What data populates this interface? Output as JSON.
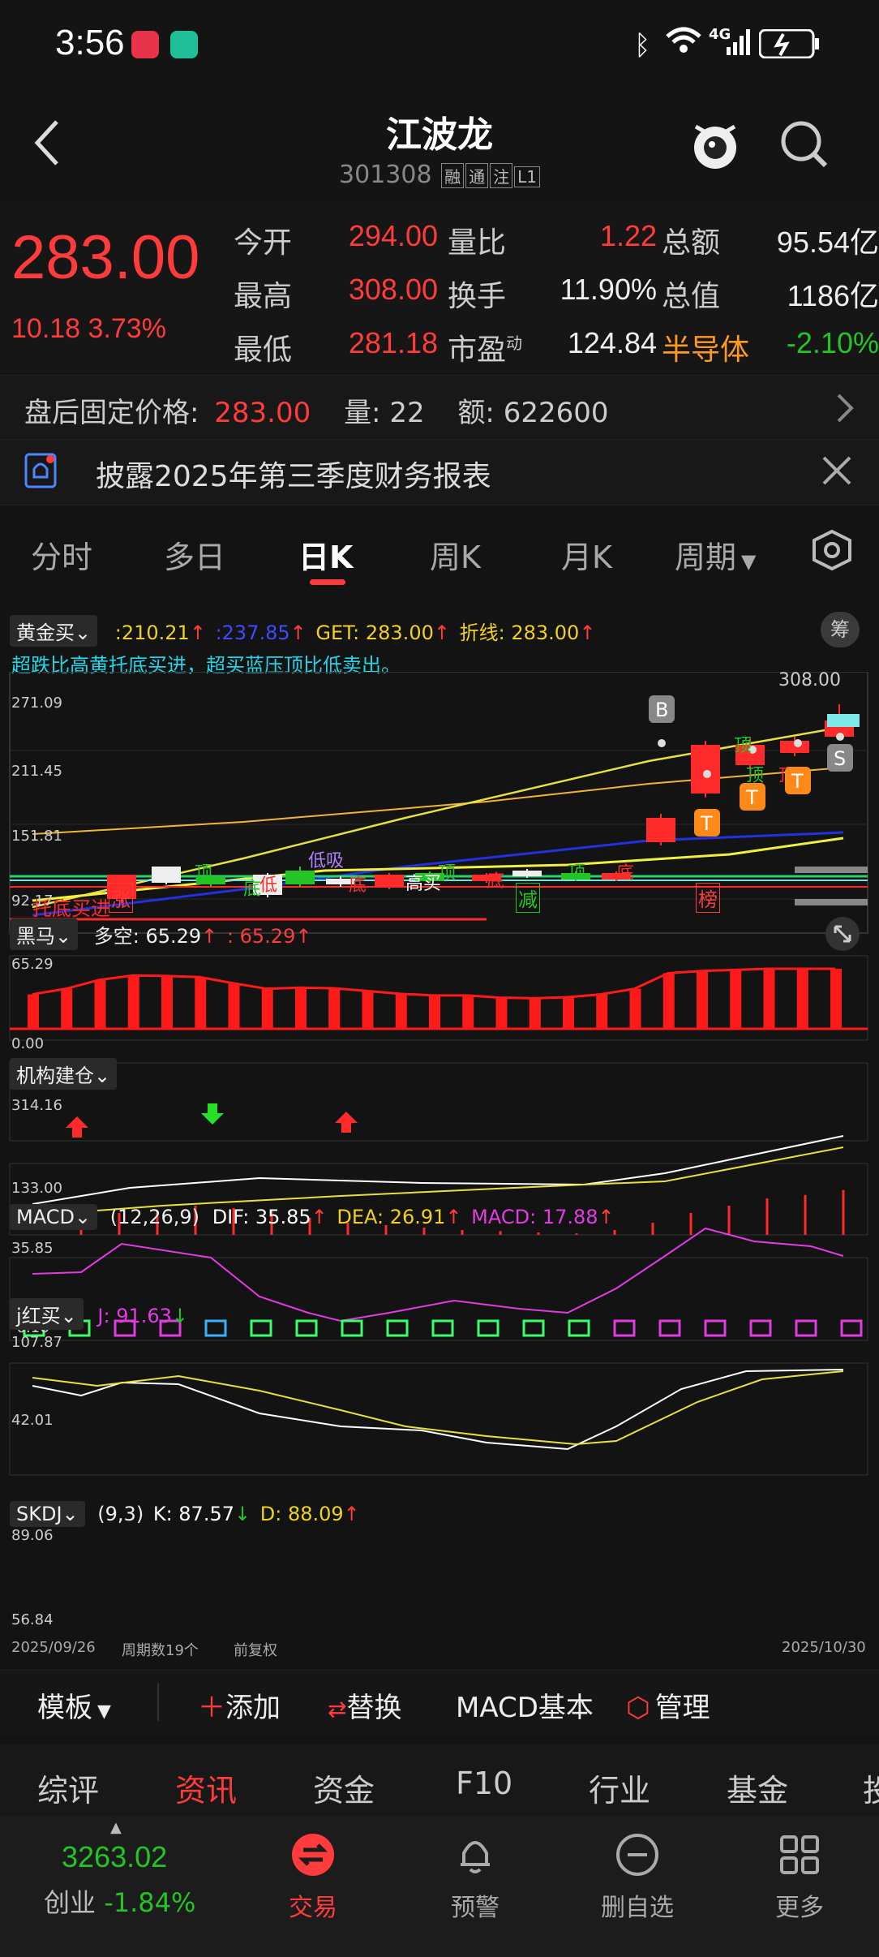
{
  "status": {
    "time": "3:56",
    "network": "4G"
  },
  "header": {
    "title": "江波龙",
    "code": "301308",
    "tags": [
      "融",
      "通",
      "注",
      "L1"
    ]
  },
  "quote": {
    "price": "283.00",
    "change": "10.18",
    "change_pct": "3.73%",
    "rows": [
      [
        {
          "l": "今开",
          "v": "294.00",
          "c": "red"
        },
        {
          "l": "量比",
          "v": "1.22",
          "c": "red"
        },
        {
          "l": "总额",
          "v": "95.54亿",
          "c": "white"
        }
      ],
      [
        {
          "l": "最高",
          "v": "308.00",
          "c": "red"
        },
        {
          "l": "换手",
          "v": "11.90%",
          "c": "white"
        },
        {
          "l": "总值",
          "v": "1186亿",
          "c": "white"
        }
      ],
      [
        {
          "l": "最低",
          "v": "281.18",
          "c": "red"
        },
        {
          "l": "市盈",
          "v": "124.84",
          "c": "white",
          "sup": "动"
        },
        {
          "l": "半导体",
          "v": "-2.10%",
          "c": "green",
          "lc": "orange"
        }
      ]
    ]
  },
  "afterhours": {
    "label": "盘后固定价格:",
    "price": "283.00",
    "vol_label": "量:",
    "vol": "22",
    "amt_label": "额:",
    "amt": "622600"
  },
  "notice": {
    "text": "披露2025年第三季度财务报表"
  },
  "tabs": [
    "分时",
    "多日",
    "日K",
    "周K",
    "月K",
    "周期"
  ],
  "active_tab": "日K",
  "main_indicator": {
    "name": "黄金买",
    "v1": ":210.21",
    "v2": ":237.85",
    "get": "GET: 283.00",
    "zx": "折线: 283.00",
    "desc": "超跌比高黄托底买进，超买蓝压顶比低卖出。",
    "btn": "筹",
    "axis": [
      "271.09",
      "211.45",
      "151.81",
      "92.17"
    ],
    "high_label": "308.00",
    "markers": [
      "涨",
      "减",
      "榜"
    ],
    "overlay_texts": [
      "顶",
      "低",
      "低吸",
      "高买",
      "顶",
      "底",
      "顶",
      "底",
      "顶",
      "顶",
      "底",
      "底",
      "B",
      "S",
      "T",
      "T",
      "T",
      "托底买进",
      "顶"
    ]
  },
  "heima": {
    "name": "黑马",
    "dk": "多空: 65.29",
    "dk2": ": 65.29",
    "top": "65.29",
    "bot": "0.00",
    "values": [
      0.62,
      0.72,
      0.88,
      0.96,
      0.95,
      0.93,
      0.82,
      0.72,
      0.74,
      0.73,
      0.68,
      0.63,
      0.6,
      0.6,
      0.56,
      0.55,
      0.57,
      0.62,
      0.72,
      1.0,
      1.04,
      1.06,
      1.08,
      1.08,
      1.08
    ]
  },
  "jigou": {
    "name": "机构建仓",
    "top": "314.16",
    "bot": "133.00"
  },
  "macd": {
    "name": "MACD",
    "params": "(12,26,9)",
    "dif": "DIF: 35.85",
    "dea": "DEA: 26.91",
    "macd": "MACD: 17.88",
    "top": "35.85",
    "bot": "-0.16",
    "hist": [
      0.3,
      0.45,
      0.5,
      0.6,
      0.55,
      0.5,
      0.35,
      0.25,
      0.2,
      0.15,
      0.1,
      0.08,
      0.05,
      0.03,
      0.1,
      0.25,
      0.45,
      0.6,
      0.75,
      0.82,
      0.92
    ]
  },
  "jhongmai": {
    "name": "j红买",
    "j": "J: 91.63",
    "top": "107.87",
    "bot": "42.01"
  },
  "skdj": {
    "name": "SKDJ",
    "params": "(9,3)",
    "k": "K: 87.57",
    "d": "D: 88.09",
    "top": "89.06",
    "bot": "56.84",
    "start_date": "2025/09/26",
    "periods": "周期数19个",
    "adj": "前复权",
    "end_date": "2025/10/30"
  },
  "toolbar": {
    "template": "模板",
    "add": "添加",
    "replace": "替换",
    "macd_basic": "MACD基本",
    "manage": "管理"
  },
  "subtabs": [
    "综评",
    "资讯",
    "资金",
    "F10",
    "行业",
    "基金",
    "投"
  ],
  "active_subtab": "资讯",
  "bottomnav": {
    "index_value": "3263.02",
    "index_name": "创业",
    "index_pct": "-1.84%",
    "items": [
      "交易",
      "预警",
      "删自选",
      "更多"
    ]
  }
}
